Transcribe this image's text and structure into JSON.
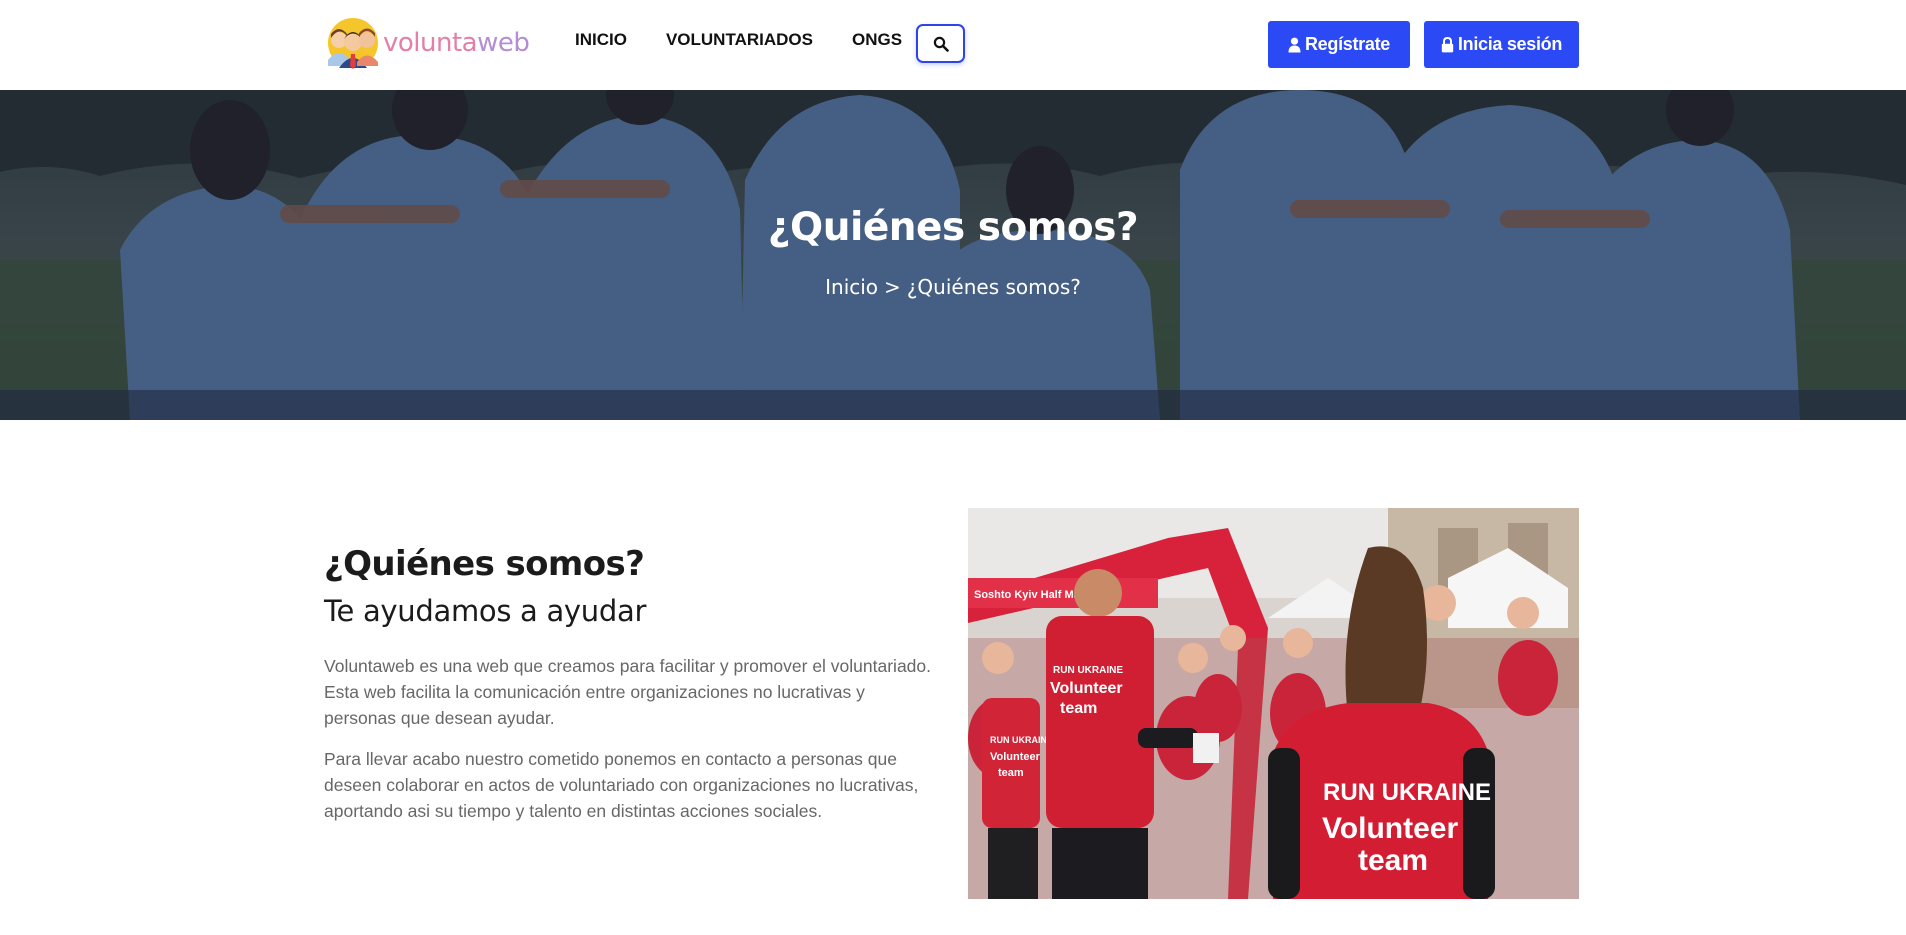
{
  "brand": {
    "name_part1": "volunta",
    "name_part2": "web"
  },
  "nav": {
    "items": [
      {
        "label": "INICIO"
      },
      {
        "label": "VOLUNTARIADOS"
      },
      {
        "label": "ONGS"
      }
    ],
    "search_icon": "search-icon"
  },
  "auth": {
    "register_label": "Regístrate",
    "register_icon": "user-icon",
    "login_label": "Inicia sesión",
    "login_icon": "lock-icon"
  },
  "hero": {
    "title": "¿Quiénes somos?",
    "breadcrumb": {
      "home": "Inicio",
      "separator": ">",
      "current": "¿Quiénes somos?"
    }
  },
  "about": {
    "title": "¿Quiénes somos?",
    "subtitle": "Te ayudamos a ayudar",
    "paragraphs": [
      "Voluntaweb es una web que creamos para facilitar y promover el voluntariado. Esta web facilita la comunicación entre organizaciones no lucrativas y personas que desean ayudar.",
      "Para llevar acabo nuestro cometido ponemos en contacto a personas que deseen colaborar en actos de voluntariado con organizaciones no lucrativas, aportando asi su tiempo y talento en distintas acciones sociales."
    ],
    "photo": {
      "arch_banner": "Soshto Kyiv Half Marathon",
      "shirt1_brand": "RUN UKRAINE",
      "shirt1_line1": "Volunteer",
      "shirt1_line2": "team",
      "shirt2_brand": "RUN UKRAINE",
      "shirt2_line1": "Volunteer",
      "shirt2_line2": "team",
      "shirt3_brand": "RUN UKRAINE",
      "shirt3_line1": "Volunteer",
      "shirt3_line2": "team"
    }
  },
  "colors": {
    "primary": "#2b49f4",
    "hero_overlay": "#161e37",
    "text_dark": "#1b1b1b",
    "text_body": "#676767",
    "logo_pink": "#e47fa8",
    "logo_purple": "#b48ed4"
  }
}
